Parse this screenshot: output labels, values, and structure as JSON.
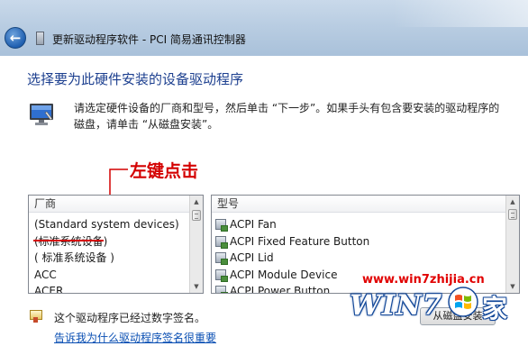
{
  "window": {
    "title": "更新驱动程序软件 - PCI 简易通讯控制器"
  },
  "page": {
    "heading": "选择要为此硬件安装的设备驱动程序",
    "instruction": "请选定硬件设备的厂商和型号，然后单击 “下一步”。如果手头有包含要安装的驱动程序的磁盘，请单击 “从磁盘安装”。"
  },
  "annotation": {
    "text": "左键点击",
    "color": "#d40000"
  },
  "manufacturer_list": {
    "header": "厂商",
    "items": [
      "(Standard system devices)",
      "(标准系统设备)",
      "( 标准系统设备 )",
      "ACC",
      "ACER"
    ]
  },
  "model_list": {
    "header": "型号",
    "items": [
      "ACPI Fan",
      "ACPI Fixed Feature Button",
      "ACPI Lid",
      "ACPI Module Device",
      "ACPI Power Button"
    ]
  },
  "signature": {
    "status": "这个驱动程序已经过数字签名。",
    "link": "告诉我为什么驱动程序签名很重要"
  },
  "buttons": {
    "have_disk": "从磁盘安装"
  },
  "watermark": {
    "url": "www.win7zhijia.cn",
    "logo": "WIN7",
    "home": "家"
  },
  "icons": {
    "back": "back-arrow-icon",
    "device": "device-manager-icon",
    "monitor": "monitor-icon",
    "certificate": "certificate-icon",
    "windows_flag": "windows-flag-icon"
  },
  "colors": {
    "heading": "#1c3f8f",
    "link": "#0a4fb3",
    "annotation": "#d40000"
  }
}
